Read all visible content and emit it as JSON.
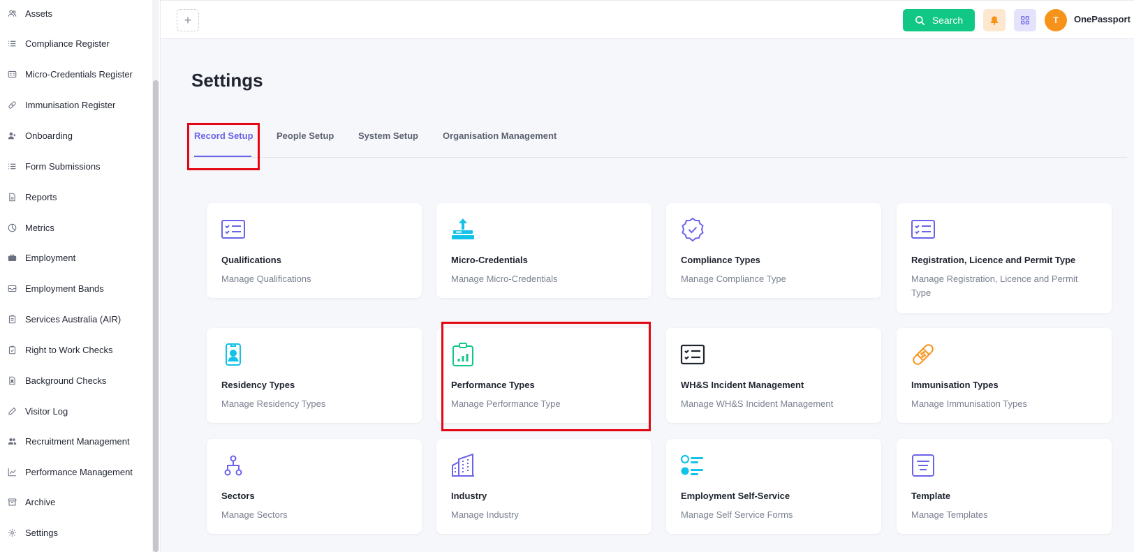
{
  "sidebar": {
    "items": [
      {
        "label": "Assets",
        "icon": "users-icon"
      },
      {
        "label": "Compliance Register",
        "icon": "list-icon"
      },
      {
        "label": "Micro-Credentials Register",
        "icon": "id-card-icon"
      },
      {
        "label": "Immunisation Register",
        "icon": "bandage-icon"
      },
      {
        "label": "Onboarding",
        "icon": "user-plus-icon"
      },
      {
        "label": "Form Submissions",
        "icon": "list-icon"
      },
      {
        "label": "Reports",
        "icon": "document-icon"
      },
      {
        "label": "Metrics",
        "icon": "pie-chart-icon"
      },
      {
        "label": "Employment",
        "icon": "briefcase-icon"
      },
      {
        "label": "Employment Bands",
        "icon": "inbox-icon"
      },
      {
        "label": "Services Australia (AIR)",
        "icon": "clipboard-icon"
      },
      {
        "label": "Right to Work Checks",
        "icon": "clipboard-check-icon"
      },
      {
        "label": "Background Checks",
        "icon": "file-user-icon"
      },
      {
        "label": "Visitor Log",
        "icon": "pen-icon"
      },
      {
        "label": "Recruitment Management",
        "icon": "people-icon"
      },
      {
        "label": "Performance Management",
        "icon": "line-chart-icon"
      },
      {
        "label": "Archive",
        "icon": "archive-icon"
      },
      {
        "label": "Settings",
        "icon": "gear-icon"
      }
    ]
  },
  "header": {
    "add_label": "+",
    "search_label": "Search",
    "avatar_initial": "T",
    "org_name": "OnePassport"
  },
  "page": {
    "title": "Settings"
  },
  "tabs": [
    {
      "label": "Record Setup",
      "active": true
    },
    {
      "label": "People Setup",
      "active": false
    },
    {
      "label": "System Setup",
      "active": false
    },
    {
      "label": "Organisation Management",
      "active": false
    }
  ],
  "cards": [
    {
      "title": "Qualifications",
      "desc": "Manage Qualifications",
      "icon": "checklist-icon"
    },
    {
      "title": "Micro-Credentials",
      "desc": "Manage Micro-Credentials",
      "icon": "upload-box-icon"
    },
    {
      "title": "Compliance Types",
      "desc": "Manage Compliance Type",
      "icon": "badge-check-icon"
    },
    {
      "title": "Registration, Licence and Permit Type",
      "desc": "Manage Registration, Licence and Permit Type",
      "icon": "checklist-icon"
    },
    {
      "title": "Residency Types",
      "desc": "Manage Residency Types",
      "icon": "id-badge-icon"
    },
    {
      "title": "Performance Types",
      "desc": "Manage Performance Type",
      "icon": "clipboard-chart-icon"
    },
    {
      "title": "WH&S Incident Management",
      "desc": "Manage WH&S Incident Management",
      "icon": "checklist-dark-icon"
    },
    {
      "title": "Immunisation Types",
      "desc": "Manage Immunisation Types",
      "icon": "bandage-icon"
    },
    {
      "title": "Sectors",
      "desc": "Manage Sectors",
      "icon": "hierarchy-icon"
    },
    {
      "title": "Industry",
      "desc": "Manage Industry",
      "icon": "buildings-icon"
    },
    {
      "title": "Employment Self-Service",
      "desc": "Manage Self Service Forms",
      "icon": "toggle-list-icon"
    },
    {
      "title": "Template",
      "desc": "Manage Templates",
      "icon": "template-icon"
    }
  ],
  "colors": {
    "accent": "#6b63e8",
    "search": "#10c785",
    "avatar": "#f7931a",
    "highlight": "#e30613",
    "cyan": "#13c2e8",
    "green": "#10c785",
    "orange": "#f7931a"
  }
}
